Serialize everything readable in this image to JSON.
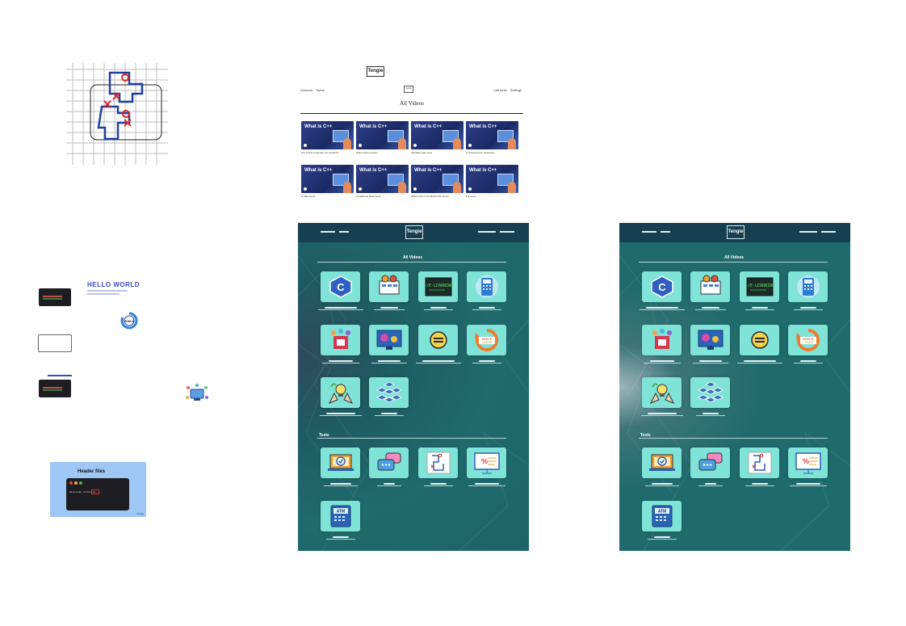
{
  "maze": {
    "marks": [
      "x-mark",
      "x-mark",
      "x-mark",
      "o-mark",
      "o-mark"
    ]
  },
  "left_assets": {
    "hello_world": "HELLO WORLD",
    "while_badge": "WHILE",
    "header_card": {
      "title": "Header files",
      "code": "#include <stdio.h>",
      "footer": "Tengie"
    }
  },
  "wireframe": {
    "logo": "Tengie",
    "nav_left": [
      "Lessons",
      "Todos"
    ],
    "nav_mid": "Sesh",
    "nav_right": [
      "Lab tools",
      "Settings"
    ],
    "heading": "All Videos",
    "cards": [
      {
        "title": "What is C++",
        "caption": "Our Training and why we created it"
      },
      {
        "title": "What is C++",
        "caption": "Hello world program"
      },
      {
        "title": "What is C++",
        "caption": "Variables and types"
      },
      {
        "title": "What is C++",
        "caption": "C Programming Operators"
      },
      {
        "title": "What is C++",
        "caption": "If statements"
      },
      {
        "title": "What is C++",
        "caption": "Conditional statements"
      },
      {
        "title": "What is C++",
        "caption": "While loops in programming course"
      },
      {
        "title": "What is C++",
        "caption": "For loops"
      }
    ]
  },
  "app": {
    "brand": "Tengie",
    "section_videos": "All Videos",
    "section_tests": "Tests",
    "video_tiles": [
      "c-plus-plus-icon",
      "computer-gears-icon",
      "terminal-learning-icon",
      "calculator-icon",
      "data-types-icon",
      "monitor-gear-icon",
      "operator-icon",
      "while-loop-icon",
      "idea-hands-icon",
      "cube-network-icon"
    ],
    "test_tiles": [
      "laptop-check-icon",
      "chat-bubbles-icon",
      "maze-map-icon",
      "percent-whiteboard-icon",
      "atm-icon"
    ],
    "while_label": "WHILE LOOPS",
    "atm_label": "ATM"
  },
  "colors": {
    "panel_top": "#173f52",
    "tile": "#7fe3d8",
    "accent_blue": "#3b47c9"
  }
}
